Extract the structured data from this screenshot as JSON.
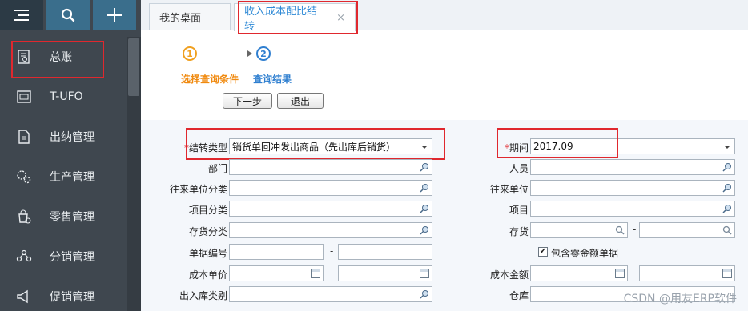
{
  "topbar": {
    "menu_icon": "menu-icon",
    "search_icon": "search-icon",
    "add_icon": "plus-icon"
  },
  "sidebar": {
    "items": [
      {
        "label": "总账",
        "icon": "ledger-icon"
      },
      {
        "label": "T-UFO",
        "icon": "tufo-icon"
      },
      {
        "label": "出纳管理",
        "icon": "cashier-icon"
      },
      {
        "label": "生产管理",
        "icon": "production-icon"
      },
      {
        "label": "零售管理",
        "icon": "retail-icon"
      },
      {
        "label": "分销管理",
        "icon": "distribution-icon"
      },
      {
        "label": "促销管理",
        "icon": "promotion-icon"
      }
    ]
  },
  "tabs": [
    {
      "label": "我的桌面"
    },
    {
      "label": "收入成本配比结转",
      "close": "×"
    }
  ],
  "steps": {
    "step1_num": "1",
    "step2_num": "2",
    "step1_label": "选择查询条件",
    "step2_label": "查询结果"
  },
  "buttons": {
    "next": "下一步",
    "exit": "退出"
  },
  "form": {
    "transfer_type_label": "结转类型",
    "transfer_type_value": "销货单回冲发出商品（先出库后销货）",
    "period_label": "期间",
    "period_value": "2017.09",
    "department_label": "部门",
    "staff_label": "人员",
    "partner_category_label": "往来单位分类",
    "partner_label": "往来单位",
    "project_category_label": "项目分类",
    "project_label": "项目",
    "inventory_category_label": "存货分类",
    "inventory_label": "存货",
    "doc_no_label": "单据编号",
    "include_zero_label": "包含零金额单据",
    "include_zero_checked": "✔",
    "unit_cost_label": "成本单价",
    "cost_amount_label": "成本金额",
    "io_type_label": "出入库类别",
    "warehouse_label": "仓库",
    "range_sep": "-"
  },
  "watermark": "CSDN @用友ERP软件",
  "colors": {
    "highlight": "#e0282e",
    "accent": "#2f8ad6",
    "step1": "#f08a10"
  }
}
